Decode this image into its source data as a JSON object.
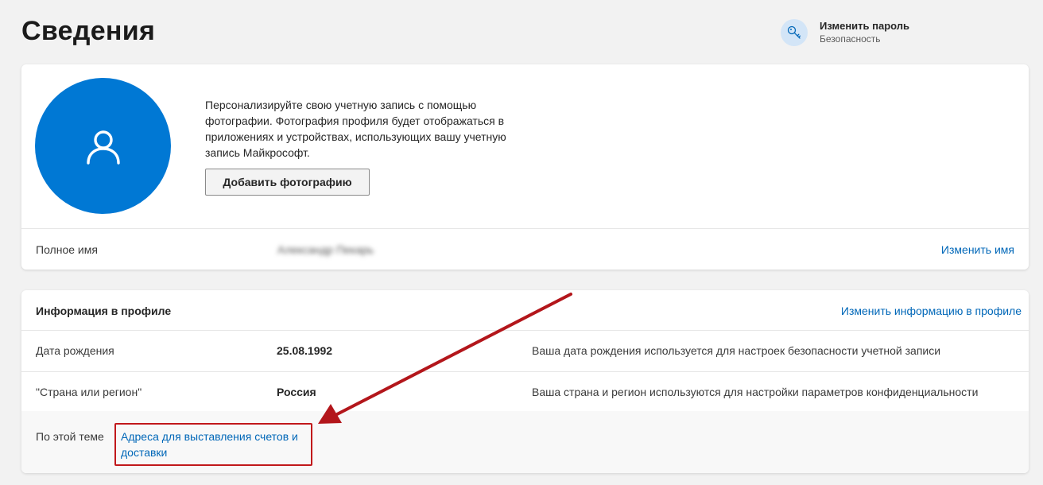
{
  "header": {
    "title": "Сведения",
    "quick_link": {
      "title": "Изменить пароль",
      "subtitle": "Безопасность",
      "icon": "key-icon"
    }
  },
  "profile_card": {
    "avatar_icon": "user-icon",
    "photo_description": "Персонализируйте свою учетную запись с помощью фотографии. Фотография профиля будет отображаться в приложениях и устройствах, использующих вашу учетную запись Майкрософт.",
    "add_photo_label": "Добавить фотографию",
    "full_name_label": "Полное имя",
    "full_name_value": "Александр Пекарь",
    "edit_name_label": "Изменить имя"
  },
  "profile_info": {
    "title": "Информация в профиле",
    "edit_label": "Изменить информацию в профиле",
    "rows": [
      {
        "label": "Дата рождения",
        "value": "25.08.1992",
        "description": "Ваша дата рождения используется для настроек безопасности учетной записи"
      },
      {
        "label": "\"Страна или регион\"",
        "value": "Россия",
        "description": "Ваша страна и регион используются для настройки параметров конфиденциальности"
      }
    ],
    "related": {
      "label": "По этой теме",
      "link_label": "Адреса для выставления счетов и доставки"
    }
  },
  "colors": {
    "accent": "#0078d4",
    "link": "#0067b8",
    "annotation": "#c1181b",
    "background": "#f2f2f2"
  }
}
